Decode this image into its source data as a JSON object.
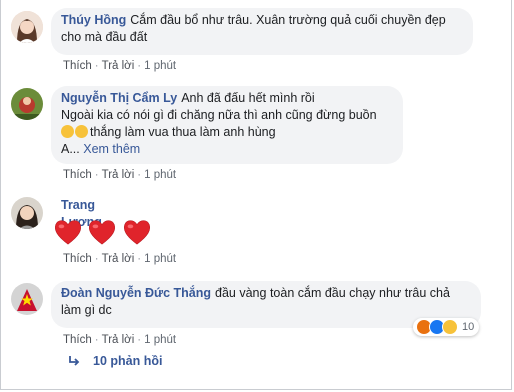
{
  "actions": {
    "like": "Thích",
    "reply": "Trả lời",
    "dot": "·"
  },
  "comments": [
    {
      "author": "Thúy Hồng",
      "text": "Cắm đầu bổ như trâu. Xuân trường quả cuối chuyền đẹp cho mà đầu đất",
      "time": "1 phút"
    },
    {
      "author": "Nguyễn Thị Cẩm Ly",
      "line1": "Anh đã đấu hết mình rồi",
      "line2": "Ngoài kia có nói gì đi chăng nữa thì anh cũng đừng buồn",
      "line3": "thắng làm vua thua làm anh hùng",
      "more_prefix": "A...",
      "see_more": "Xem thêm",
      "time": "1 phút"
    },
    {
      "author": "Trang Lương",
      "time": "1 phút"
    },
    {
      "author": "Đoàn Nguyễn Đức Thắng",
      "text": "đầu vàng toàn cắm đầu chạy như trâu chả làm gì dc",
      "time": "1 phút",
      "reaction_count": "10"
    }
  ],
  "replies": {
    "label": "10 phản hồi"
  },
  "colors": {
    "link": "#385898",
    "bubble": "#f2f3f5",
    "heart": "#e0242b"
  }
}
